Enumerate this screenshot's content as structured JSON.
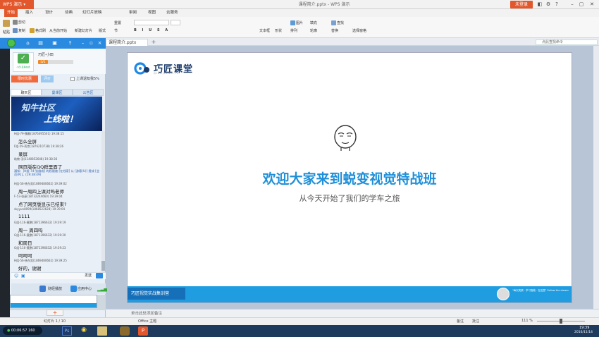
{
  "app": {
    "name": "WPS 演示",
    "doc_title": "课程简介.pptx - WPS 演示",
    "login": "未登录"
  },
  "menu": [
    "开始",
    "插入",
    "设计",
    "动画",
    "幻灯片放映",
    "审阅",
    "视图",
    "云服务"
  ],
  "ribbon": {
    "groups": [
      "剪切",
      "复制",
      "格式刷",
      "从当前开始",
      "新建幻灯片",
      "版式",
      "重置",
      "节",
      "文本框",
      "形状",
      "图片",
      "填充",
      "排列",
      "轮廓",
      "查找",
      "替换",
      "选择窗格"
    ],
    "paste": "粘贴"
  },
  "tabs": {
    "doc": "课程简介.pptx",
    "search": "点此查找命令"
  },
  "panel": {
    "user_name": "巧匠-小田",
    "level": "LV1",
    "avatar_caption": "小田-直播在线",
    "btn_sale": "限时优惠",
    "btn_eval": "评价",
    "exit_label": "上课退知我5%",
    "tabs": [
      "聊天区",
      "曼课区",
      "公告区"
    ],
    "banner_l1": "知牛社区",
    "banner_l2": "上线啦！",
    "messages": [
      {
        "meta": "H组-79-魏雕(1876495501) 19:38:15",
        "text": "怎么全屏"
      },
      {
        "meta": "F组-59-蒋崇(1876210738) 19:38:26",
        "text": "录屏"
      },
      {
        "meta": "助教-羽(1140852648) 19:38:36",
        "text": "网页版在QQ群里面了"
      },
      {
        "notice": "通知：[H组-74-张维成] 的权限被 [在线家] 从 [游客(U)] 提成 [会员(R)]。(19:38:49)"
      },
      {
        "meta": "H组-56-杨东男(1869480662) 19:39:02",
        "text": "周一周四上课对吗老师"
      },
      {
        "meta": "F-53-张豪(18732244660) 19:39:04",
        "text": "点了网页版显示已结束?"
      },
      {
        "meta": "skyyun8099(1868522628) 19:39:04",
        "text": "1111"
      },
      {
        "meta": "G组-116-黄鹏(1871396632) 19:39:19",
        "text": "周一   周四吗"
      },
      {
        "meta": "G组-116-黄鹏(1871396632) 19:39:20",
        "text": "和周日"
      },
      {
        "meta": "G组-116-黄鹏(1871396632) 19:39:23",
        "text": "呵呵呵"
      },
      {
        "meta": "H组-56-杨东男(1869480662) 19:39:25",
        "text": "好的，谢谢"
      }
    ],
    "send": "发送",
    "clear": "财经播放",
    "app_center": "应用中心"
  },
  "slide": {
    "logo_text": "巧匠课堂",
    "logo_sub": "QIAOJIANG.TV",
    "title": "欢迎大家来到蜕变视觉特战班",
    "subtitle": "从今天开始了我们的学车之旅",
    "footer_tag": "巧匠视觉实战集训营",
    "footer_quote": "\"每天笑颜 · 学习智能 · 在这里\" Follow the dream"
  },
  "notes_placeholder": "单击此处添加备注",
  "status": {
    "slide": "幻灯片 1 / 10",
    "theme": "Office 主题",
    "notes": "备注",
    "comment": "批注",
    "zoom": "111 %"
  },
  "taskbar": {
    "timer": "00:06:57",
    "user": "160",
    "time": "19:39",
    "date": "2016/11/14"
  },
  "colors": {
    "accent": "#e2572b",
    "title_blue": "#1e8fd8",
    "footer_blue": "#1f9de0",
    "panel_blue": "#2a8ae0"
  }
}
